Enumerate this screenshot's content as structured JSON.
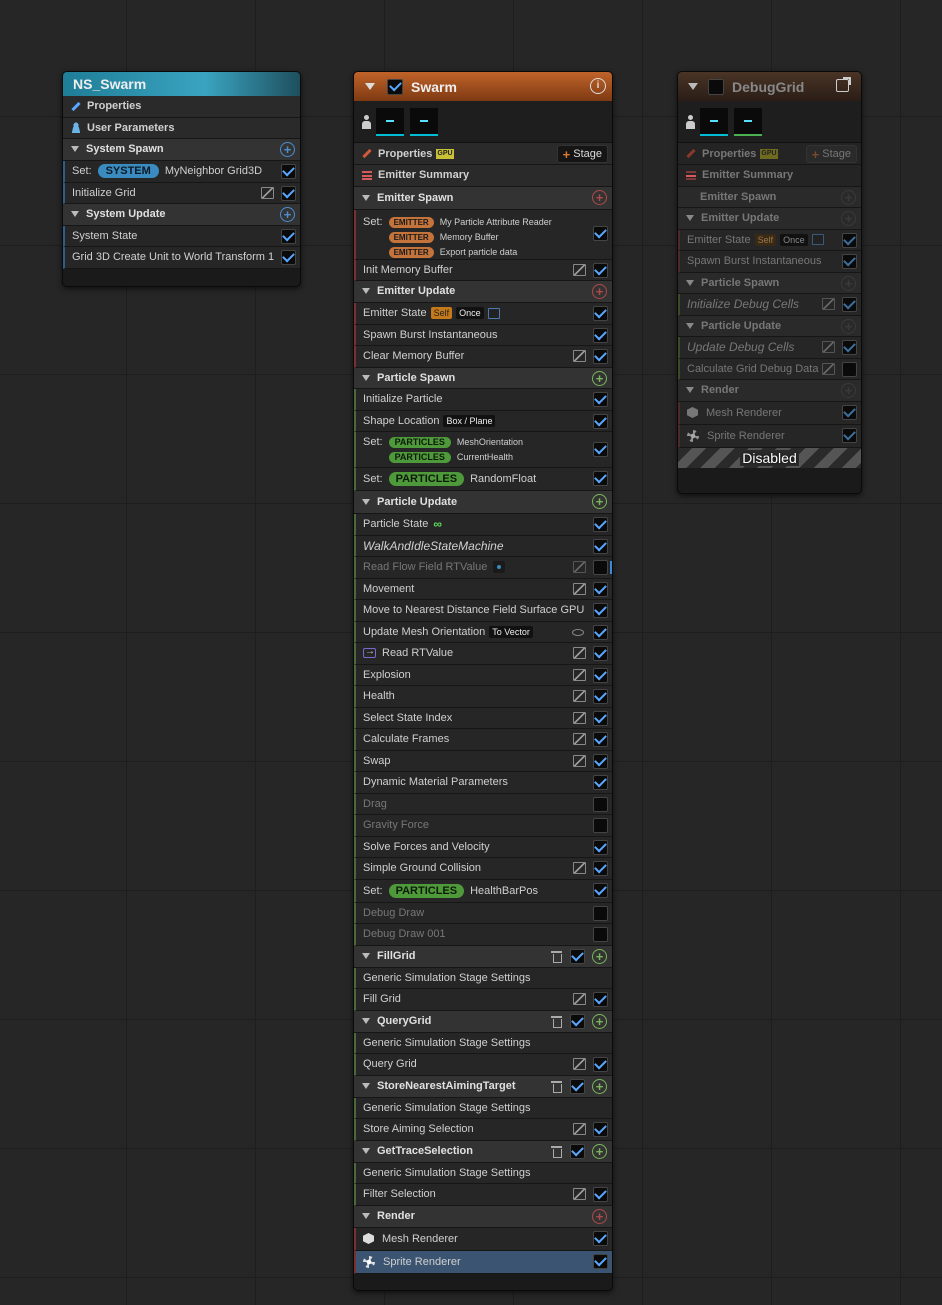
{
  "system_node": {
    "title": "NS_Swarm",
    "properties": "Properties",
    "user_parameters": "User Parameters",
    "system_spawn": "System Spawn",
    "set_label": "Set:",
    "set_pill": "SYSTEM",
    "set_value": "MyNeighbor Grid3D",
    "initialize_grid": "Initialize Grid",
    "system_update": "System Update",
    "system_state": "System State",
    "grid_transform": "Grid 3D Create Unit to World Transform 1"
  },
  "swarm": {
    "title": "Swarm",
    "properties": "Properties",
    "gpu": "GPU",
    "stage_label": "Stage",
    "emitter_summary": "Emitter Summary",
    "emitter_spawn": "Emitter Spawn",
    "set_label": "Set:",
    "emitter_pill": "EMITTER",
    "set_items": [
      "My Particle Attribute Reader",
      "Memory Buffer",
      "Export particle data"
    ],
    "init_memory_buffer": "Init Memory Buffer",
    "emitter_update": "Emitter Update",
    "emitter_state": "Emitter State",
    "self_tag": "Self",
    "once_tag": "Once",
    "spawn_burst": "Spawn Burst Instantaneous",
    "clear_memory_buffer": "Clear Memory Buffer",
    "particle_spawn": "Particle Spawn",
    "initialize_particle": "Initialize Particle",
    "shape_location": "Shape Location",
    "shape_tag": "Box / Plane",
    "particles_pill": "PARTICLES",
    "spawn_set_items": [
      "MeshOrientation",
      "CurrentHealth"
    ],
    "random_float": "RandomFloat",
    "particle_update": "Particle Update",
    "particle_state": "Particle State",
    "infinity": "∞",
    "walk_idle": "WalkAndIdleStateMachine",
    "read_flow": "Read Flow Field RTValue",
    "movement": "Movement",
    "move_nearest": "Move to Nearest Distance Field Surface GPU",
    "update_mesh_orientation": "Update Mesh Orientation",
    "to_vector": "To Vector",
    "read_rtvalue": "Read RTValue",
    "explosion": "Explosion",
    "health": "Health",
    "select_state_index": "Select State Index",
    "calculate_frames": "Calculate Frames",
    "swap": "Swap",
    "dynamic_material": "Dynamic Material Parameters",
    "drag": "Drag",
    "gravity_force": "Gravity Force",
    "solve_forces": "Solve Forces and Velocity",
    "simple_ground": "Simple Ground Collision",
    "health_bar_pos": "HealthBarPos",
    "debug_draw": "Debug Draw",
    "debug_draw_001": "Debug Draw 001",
    "generic_sim": "Generic Simulation Stage Settings",
    "fill_grid_section": "FillGrid",
    "fill_grid": "Fill Grid",
    "query_grid_section": "QueryGrid",
    "query_grid": "Query Grid",
    "store_section": "StoreNearestAimingTarget",
    "store_aiming": "Store Aiming Selection",
    "trace_section": "GetTraceSelection",
    "filter_selection": "Filter Selection",
    "render": "Render",
    "mesh_renderer": "Mesh Renderer",
    "sprite_renderer": "Sprite Renderer"
  },
  "debug": {
    "title": "DebugGrid",
    "properties": "Properties",
    "gpu": "GPU",
    "stage_label": "Stage",
    "emitter_summary": "Emitter Summary",
    "emitter_spawn": "Emitter Spawn",
    "emitter_update": "Emitter Update",
    "emitter_state": "Emitter State",
    "self_tag": "Self",
    "once_tag": "Once",
    "spawn_burst": "Spawn Burst Instantaneous",
    "particle_spawn": "Particle Spawn",
    "init_debug_cells": "Initialize Debug Cells",
    "particle_update": "Particle Update",
    "update_debug_cells": "Update Debug Cells",
    "calc_grid_debug": "Calculate Grid Debug Data",
    "render": "Render",
    "mesh_renderer": "Mesh Renderer",
    "sprite_renderer": "Sprite Renderer",
    "disabled": "Disabled"
  },
  "colors": {
    "accent_blue": "#5aa7ff",
    "swarm_header": "#b2561d",
    "system_header": "#2b8fa8",
    "debug_header": "#5a3a2a"
  }
}
